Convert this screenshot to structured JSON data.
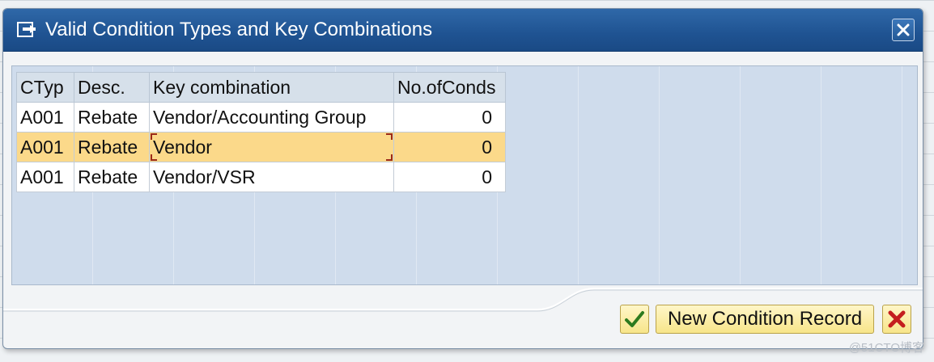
{
  "dialog": {
    "title": "Valid Condition Types and Key Combinations",
    "title_icon": "window-icon",
    "close_icon": "close-icon"
  },
  "table": {
    "columns": [
      "CTyp",
      "Desc.",
      "Key combination",
      "No.ofConds"
    ],
    "rows": [
      {
        "ctyp": "A001",
        "desc": "Rebate",
        "key": "Vendor/Accounting Group",
        "num": "0",
        "selected": false
      },
      {
        "ctyp": "A001",
        "desc": "Rebate",
        "key": "Vendor",
        "num": "0",
        "selected": true
      },
      {
        "ctyp": "A001",
        "desc": "Rebate",
        "key": "Vendor/VSR",
        "num": "0",
        "selected": false
      }
    ]
  },
  "buttons": {
    "ok_icon": "checkmark-icon",
    "new_condition_label": "New Condition Record",
    "cancel_icon": "cancel-icon"
  },
  "watermark": "@51CTO博客",
  "colors": {
    "titlebar": "#1f5392",
    "selected_row": "#fbd98a",
    "table_area": "#cfdcec",
    "button": "#f7e58a"
  }
}
